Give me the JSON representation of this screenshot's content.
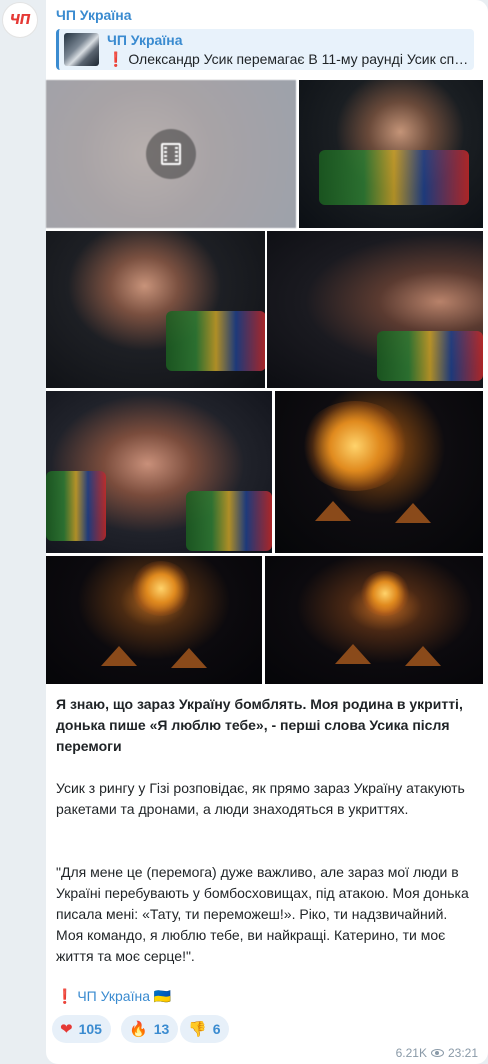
{
  "channel": {
    "avatar_text": "ЧП",
    "name": "ЧП Україна"
  },
  "reply": {
    "title": "ЧП Україна",
    "excl": "❗",
    "text": "Олександр Усик перемагає В 11-му раунді Усик сп…"
  },
  "message": {
    "title": "Я знаю, що зараз Україну бомблять. Моя родина в укритті, донька пише «Я люблю тебе», - перші слова Усика після перемоги",
    "paragraph_1": "Усик з рингу у Гізі розповідає, як прямо зараз Україну атакують ракетами та дронами, а люди знаходяться в укриттях.",
    "paragraph_2": "\"Для мене це (перемога) дуже важливо, але зараз мої люди в Україні перебувають у бомбосховищах, під атакою. Моя донька писала мені: «Тату, ти переможеш!». Ріко, ти надзвичайний. Моя командо, я люблю тебе, ви найкращі. Катерино, ти моє життя та моє серце!\".",
    "signature_excl": "❗",
    "signature_name": "ЧП Україна 🇺🇦"
  },
  "reactions": [
    {
      "icon": "heart-icon",
      "glyph": "❤",
      "count": "105"
    },
    {
      "icon": "fire-icon",
      "glyph": "🔥",
      "count": "13"
    },
    {
      "icon": "thumbs-down-icon",
      "glyph": "👎",
      "count": "6"
    }
  ],
  "meta": {
    "views": "6.21K",
    "time": "23:21"
  },
  "colors": {
    "accent": "#3a8bd0",
    "background": "#e9eef2",
    "bubble": "#ffffff",
    "reaction_bg": "#e7f0f9"
  }
}
